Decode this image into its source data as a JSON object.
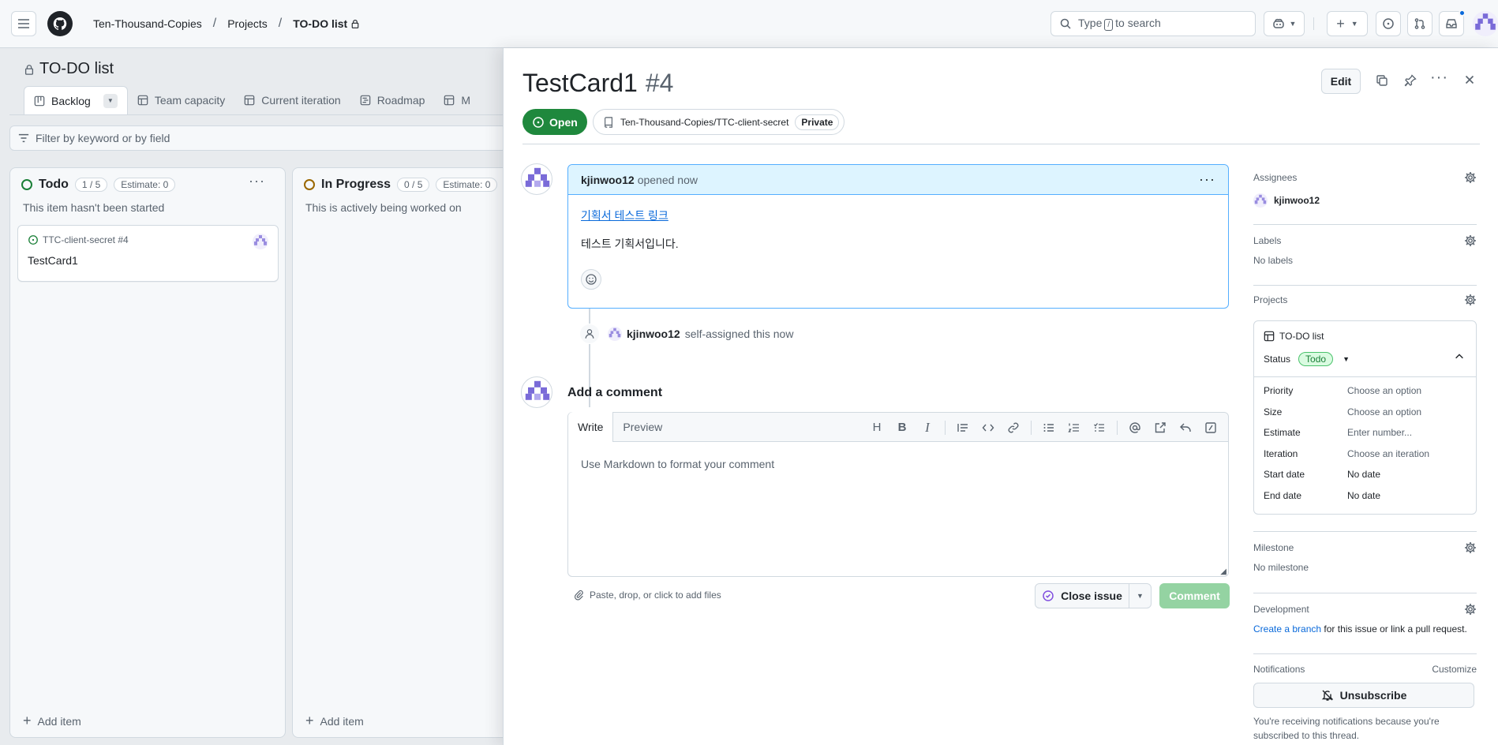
{
  "header": {
    "breadcrumbs": [
      "Ten-Thousand-Copies",
      "Projects",
      "TO-DO list"
    ],
    "search_placeholder": "Type",
    "search_suffix": "to search",
    "search_key": "/"
  },
  "project": {
    "title": "TO-DO list",
    "views": [
      "Backlog",
      "Team capacity",
      "Current iteration",
      "Roadmap",
      "M"
    ],
    "filter_placeholder": "Filter by keyword or by field",
    "columns": [
      {
        "name": "Todo",
        "count": "1 / 5",
        "estimate": "Estimate: 0",
        "description": "This item hasn't been started",
        "color": "#1a7f37"
      },
      {
        "name": "In Progress",
        "count": "0 / 5",
        "estimate": "Estimate: 0",
        "description": "This is actively being worked on",
        "color": "#9a6700"
      }
    ],
    "card": {
      "ref": "TTC-client-secret #4",
      "title": "TestCard1"
    },
    "add_item": "Add item"
  },
  "issue": {
    "title": "TestCard1",
    "number": "#4",
    "edit_label": "Edit",
    "state": "Open",
    "repo": "Ten-Thousand-Copies/TTC-client-secret",
    "visibility": "Private",
    "comment": {
      "author": "kjinwoo12",
      "meta": "opened now",
      "link_text": "기획서 테스트 링크",
      "body": "테스트 기획서입니다."
    },
    "event": {
      "actor": "kjinwoo12",
      "text": "self-assigned this now"
    },
    "add_comment": "Add a comment",
    "tabs": [
      "Write",
      "Preview"
    ],
    "editor_placeholder": "Use Markdown to format your comment",
    "attach_hint": "Paste, drop, or click to add files",
    "close_issue": "Close issue",
    "comment_button": "Comment"
  },
  "sidebar": {
    "assignees": {
      "label": "Assignees",
      "value": "kjinwoo12"
    },
    "labels": {
      "label": "Labels",
      "value": "No labels"
    },
    "projects": {
      "label": "Projects",
      "name": "TO-DO list",
      "status_label": "Status",
      "status_value": "Todo",
      "fields": [
        {
          "k": "Priority",
          "v": "Choose an option"
        },
        {
          "k": "Size",
          "v": "Choose an option"
        },
        {
          "k": "Estimate",
          "v": "Enter number..."
        },
        {
          "k": "Iteration",
          "v": "Choose an iteration"
        },
        {
          "k": "Start date",
          "v": "No date"
        },
        {
          "k": "End date",
          "v": "No date"
        }
      ]
    },
    "milestone": {
      "label": "Milestone",
      "value": "No milestone"
    },
    "development": {
      "label": "Development",
      "link": "Create a branch",
      "rest": "for this issue or link a pull request."
    },
    "notifications": {
      "label": "Notifications",
      "customize": "Customize",
      "button": "Unsubscribe",
      "note": "You're receiving notifications because you're subscribed to this thread."
    }
  },
  "colors": {
    "open_green": "#1f883d",
    "link_blue": "#0969da",
    "comment_header": "#ddf4ff",
    "avatar_purple": "#7a6bd8"
  }
}
